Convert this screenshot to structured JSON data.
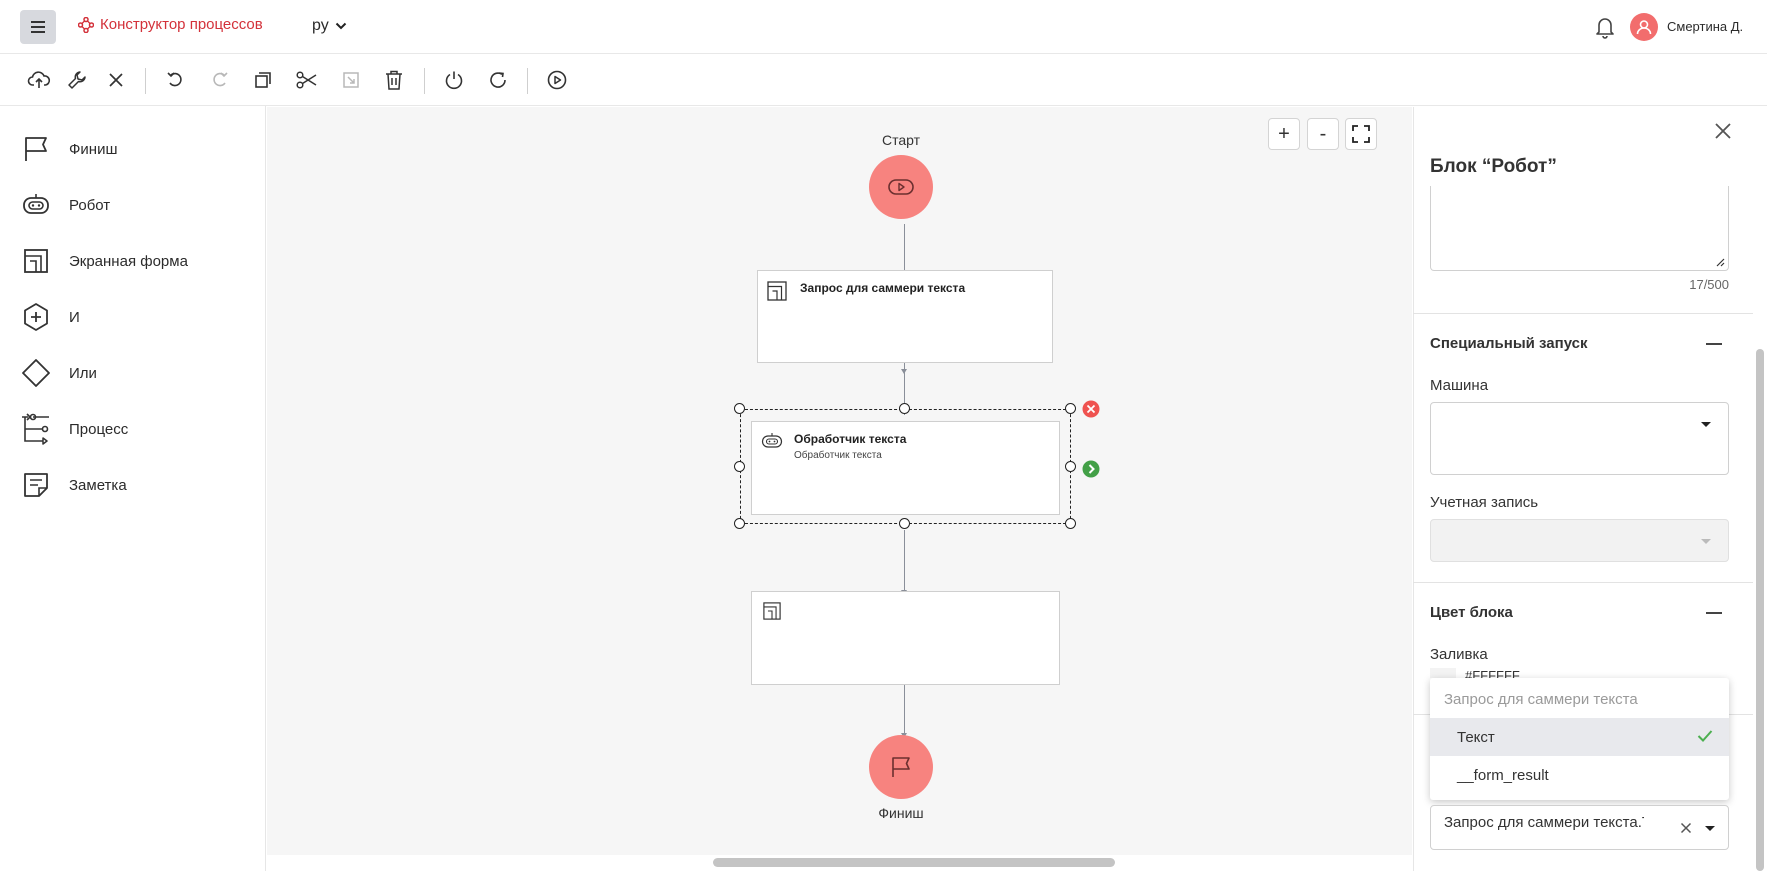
{
  "header": {
    "brand_label": "Конструктор процессов",
    "language": "ру",
    "user_name": "Смертина Д."
  },
  "toolbar": {
    "buttons": [
      "save-cloud",
      "settings",
      "close",
      "undo",
      "redo",
      "copy",
      "cut",
      "paste",
      "delete",
      "power",
      "refresh",
      "run"
    ]
  },
  "palette": {
    "items": [
      {
        "label": "Финиш",
        "icon": "flag-icon"
      },
      {
        "label": "Робот",
        "icon": "robot-icon"
      },
      {
        "label": "Экранная форма",
        "icon": "screen-form-icon"
      },
      {
        "label": "И",
        "icon": "and-hexagon-icon"
      },
      {
        "label": "Или",
        "icon": "or-diamond-icon"
      },
      {
        "label": "Процесс",
        "icon": "process-icon"
      },
      {
        "label": "Заметка",
        "icon": "note-icon"
      }
    ]
  },
  "canvas": {
    "zoom_in": "+",
    "zoom_out": "-",
    "start_label": "Старт",
    "finish_label": "Финиш",
    "node1_title": "Запрос для саммери текста",
    "node2_title": "Обработчик текста",
    "node2_subtitle": "Обработчик текста",
    "node3_title": ""
  },
  "panel": {
    "title": "Блок “Робот”",
    "char_counter": "17/500",
    "special_launch": {
      "title": "Специальный запуск",
      "machine_label": "Машина",
      "machine_value": "",
      "account_label": "Учетная запись",
      "account_value": ""
    },
    "block_color": {
      "title": "Цвет блока",
      "fill_label": "Заливка",
      "fill_hex": "#FFFFFF"
    },
    "dropdown": {
      "group_label": "Запрос для саммери текста",
      "options": [
        "Текст",
        "__form_result"
      ],
      "selected": "Текст"
    },
    "selected_value": "Запрос для саммери текста.Текст"
  },
  "colors": {
    "brand": "#d3313a",
    "node_circle": "#f7837f",
    "check_green": "#4caf50",
    "error_red": "#ef5350"
  }
}
